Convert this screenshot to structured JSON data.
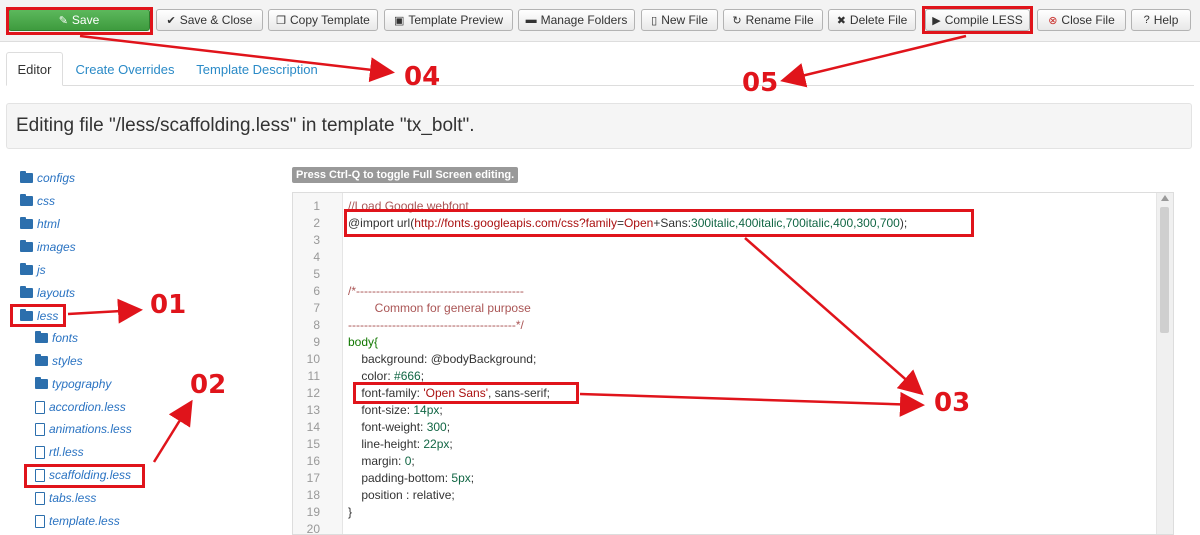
{
  "toolbar": {
    "save": "Save",
    "save_close": "Save & Close",
    "copy_template": "Copy Template",
    "template_preview": "Template Preview",
    "manage_folders": "Manage Folders",
    "new_file": "New File",
    "rename_file": "Rename File",
    "delete_file": "Delete File",
    "compile_less": "Compile LESS",
    "close_file": "Close File",
    "help": "Help"
  },
  "tabs": [
    "Editor",
    "Create Overrides",
    "Template Description"
  ],
  "heading": "Editing file \"/less/scaffolding.less\" in template \"tx_bolt\".",
  "tree": {
    "folders": [
      "configs",
      "css",
      "html",
      "images",
      "js",
      "layouts",
      "less"
    ],
    "less_children_folders": [
      "fonts",
      "styles",
      "typography"
    ],
    "less_children_files": [
      "accordion.less",
      "animations.less",
      "rtl.less",
      "scaffolding.less",
      "tabs.less",
      "template.less"
    ]
  },
  "editor": {
    "hint": "Press Ctrl-Q to toggle Full Screen editing.",
    "line_numbers": [
      "1",
      "2",
      "3",
      "4",
      "5",
      "6",
      "7",
      "8",
      "9",
      "10",
      "11",
      "12",
      "13",
      "14",
      "15",
      "16",
      "17",
      "18",
      "19",
      "20"
    ],
    "line1": "//Load Google webfont",
    "line2_import": "@import url(",
    "line2_url": "http://fonts.googleapis.com/css?family",
    "line2_eq": "=",
    "line2_open": "Open",
    "line2_plus": "+Sans:",
    "line2_weights": "300italic,400italic,700italic,400,300,700",
    "line2_end": ");",
    "line6": "/*------------------------------------------",
    "line7": "        Common for general purpose",
    "line8": "------------------------------------------*/",
    "line9": "body{",
    "line10_prop": "    background: ",
    "line10_val": "@bodyBackground;",
    "line11_prop": "    color: ",
    "line11_val": "#666",
    "line11_end": ";",
    "line12_prop": "    font-family: ",
    "line12_str": "'Open Sans'",
    "line12_end": ", sans-serif;",
    "line13_prop": "    font-size: ",
    "line13_val": "14px",
    "line14_prop": "    font-weight: ",
    "line14_val": "300",
    "line15_prop": "    line-height: ",
    "line15_val": "22px",
    "line16_prop": "    margin: ",
    "line16_val": "0",
    "line17_prop": "    padding-bottom: ",
    "line17_val": "5px",
    "line18": "    position : relative;",
    "line19": "}",
    "semi": ";"
  },
  "annotations": [
    "01",
    "02",
    "03",
    "04",
    "05"
  ],
  "colors": {
    "annotation_red": "#e0141b",
    "save_green": "#4cae4c",
    "link_blue": "#2a73c2"
  }
}
